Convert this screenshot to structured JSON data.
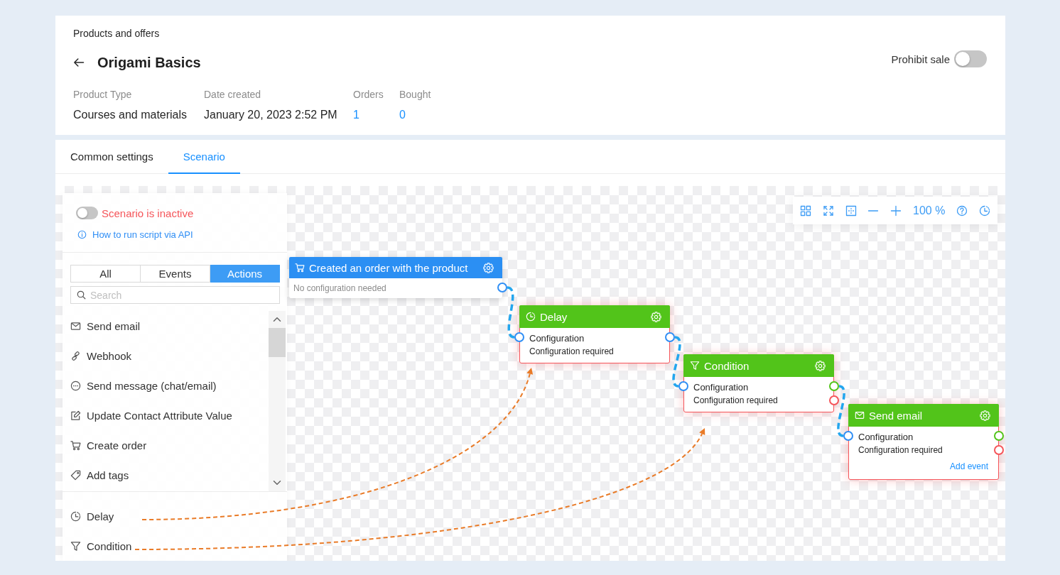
{
  "breadcrumb": "Products and offers",
  "product": {
    "title": "Origami Basics",
    "prohibit_sale": {
      "label": "Prohibit sale",
      "on": false
    },
    "details": [
      {
        "label": "Product Type",
        "value": "Courses and materials",
        "kind": "text"
      },
      {
        "label": "Date created",
        "value": "January 20, 2023 2:52 PM",
        "kind": "text"
      },
      {
        "label": "Orders",
        "value": "1",
        "kind": "link"
      },
      {
        "label": "Bought",
        "value": "0",
        "kind": "link"
      }
    ]
  },
  "tabs": [
    {
      "label": "Common settings",
      "selected": false
    },
    {
      "label": "Scenario",
      "selected": true
    }
  ],
  "scenario_panel": {
    "status": {
      "label": "Scenario is inactive",
      "on": false
    },
    "help_link": "How to run script via API",
    "filters": [
      {
        "label": "All",
        "selected": false
      },
      {
        "label": "Events",
        "selected": false
      },
      {
        "label": "Actions",
        "selected": true
      }
    ],
    "search": {
      "placeholder": "Search"
    },
    "blocks": [
      {
        "label": "Send email",
        "kind": "email"
      },
      {
        "label": "Webhook",
        "kind": "webhook"
      },
      {
        "label": "Send message (chat/email)",
        "kind": "message"
      },
      {
        "label": "Update Contact Attribute Value",
        "kind": "attribute"
      },
      {
        "label": "Create order",
        "kind": "order"
      },
      {
        "label": "Add tags",
        "kind": "tags"
      }
    ],
    "flow_blocks": [
      {
        "label": "Delay",
        "kind": "delay",
        "drag_arrow": true
      },
      {
        "label": "Condition",
        "kind": "condition",
        "drag_arrow": true
      }
    ]
  },
  "canvas": {
    "toolbar": {
      "zoom_level": "100 %"
    },
    "nodes": [
      {
        "title": "Created an order with the product",
        "kind": "order_created",
        "error": false,
        "input": false,
        "lines": [
          "No configuration needed"
        ],
        "outputs": [
          {
            "color": "#2f8ef5",
            "connected": true
          }
        ]
      },
      {
        "title": "Delay",
        "kind": "delay",
        "error": true,
        "input": true,
        "lines": [
          "Configuration",
          "Configuration required"
        ],
        "outputs": [
          {
            "color": "#2f8ef5",
            "connected": true
          }
        ]
      },
      {
        "title": "Condition",
        "kind": "condition",
        "error": true,
        "input": true,
        "lines": [
          "Configuration",
          "Configuration required"
        ],
        "outputs": [
          {
            "color": "#52c41a",
            "connected": true
          },
          {
            "color": "#f5555a",
            "connected": false
          }
        ]
      },
      {
        "title": "Send email",
        "kind": "email",
        "error": true,
        "input": true,
        "lines": [
          "Configuration",
          "Configuration required"
        ],
        "outputs": [
          {
            "color": "#52c41a"
          },
          {
            "color": "#f5555a"
          }
        ],
        "link": "Add event"
      }
    ]
  }
}
